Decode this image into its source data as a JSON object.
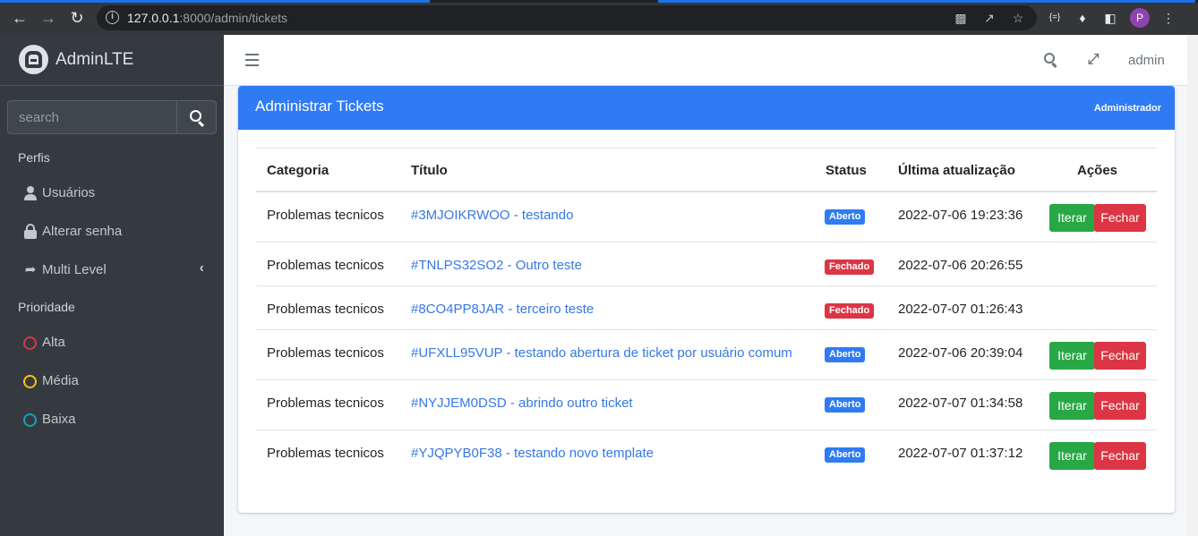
{
  "browser": {
    "url_host": "127.0.0.1",
    "url_path": ":8000/admin/tickets",
    "profile_initial": "P"
  },
  "brand": {
    "name_bold": "Admin",
    "name_light": "LTE"
  },
  "sidebar": {
    "search_placeholder": "search",
    "section_profiles": "Perfis",
    "items": [
      {
        "label": "Usuários",
        "icon": "user-icon"
      },
      {
        "label": "Alterar senha",
        "icon": "lock-icon"
      },
      {
        "label": "Multi Level",
        "icon": "share-icon"
      }
    ],
    "section_priority": "Prioridade",
    "priorities": [
      {
        "label": "Alta",
        "color": "#dc3545"
      },
      {
        "label": "Média",
        "color": "#ffc107"
      },
      {
        "label": "Baixa",
        "color": "#17a2b8"
      }
    ]
  },
  "navbar": {
    "user": "admin"
  },
  "card": {
    "title": "Administrar Tickets",
    "tool": "Administrador",
    "columns": [
      "Categoria",
      "Título",
      "Status",
      "Última atualização",
      "Ações"
    ],
    "rows": [
      {
        "category": "Problemas tecnicos",
        "title": "#3MJOIKRWOO - testando",
        "status": "Aberto",
        "updated": "2022-07-06 19:23:36",
        "actions": true
      },
      {
        "category": "Problemas tecnicos",
        "title": "#TNLPS32SO2 - Outro teste",
        "status": "Fechado",
        "updated": "2022-07-06 20:26:55",
        "actions": false
      },
      {
        "category": "Problemas tecnicos",
        "title": "#8CO4PP8JAR - terceiro teste",
        "status": "Fechado",
        "updated": "2022-07-07 01:26:43",
        "actions": false
      },
      {
        "category": "Problemas tecnicos",
        "title": "#UFXLL95VUP - testando abertura de ticket por usuário comum",
        "status": "Aberto",
        "updated": "2022-07-06 20:39:04",
        "actions": true
      },
      {
        "category": "Problemas tecnicos",
        "title": "#NYJJEM0DSD - abrindo outro ticket",
        "status": "Aberto",
        "updated": "2022-07-07 01:34:58",
        "actions": true
      },
      {
        "category": "Problemas tecnicos",
        "title": "#YJQPYB0F38 - testando novo template",
        "status": "Aberto",
        "updated": "2022-07-07 01:37:12",
        "actions": true
      }
    ],
    "btn_iterate": "Iterar",
    "btn_close": "Fechar"
  }
}
